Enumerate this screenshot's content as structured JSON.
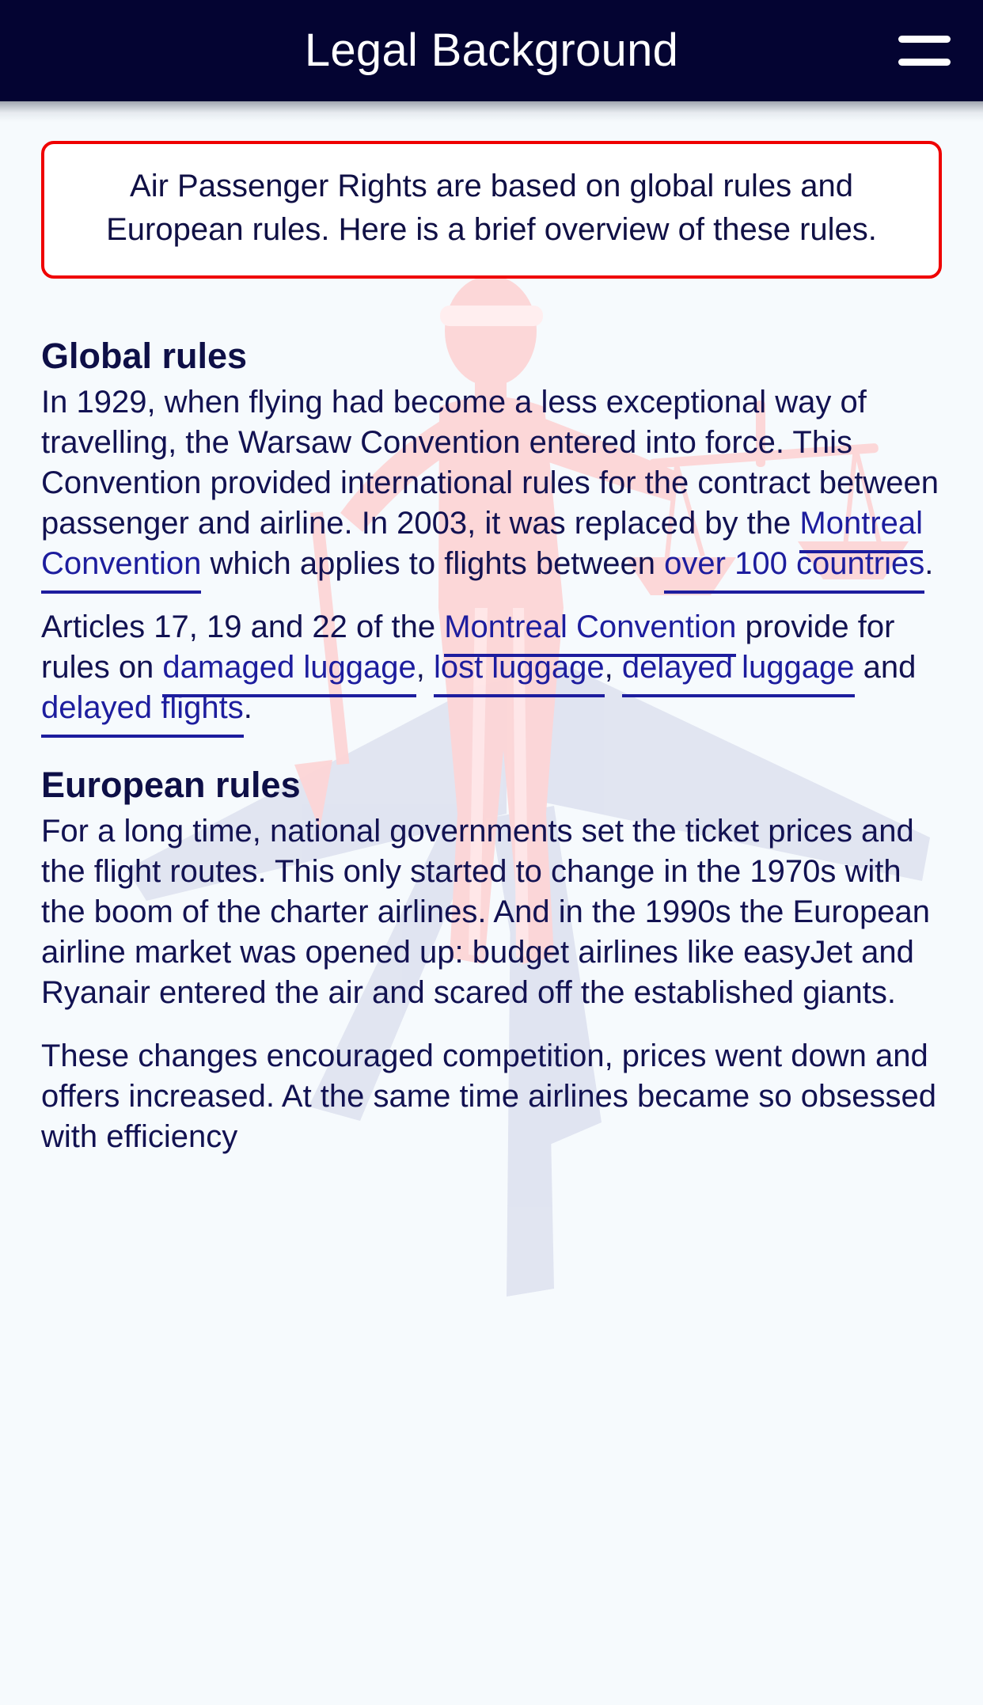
{
  "header": {
    "title": "Legal Background",
    "menu_icon": "hamburger-menu-icon",
    "background_color": "#040432",
    "title_color": "#ffffff"
  },
  "colors": {
    "page_background": "#f6fafd",
    "text": "#121252",
    "heading": "#0e0f47",
    "link": "#1d1d9e",
    "callout_border": "#ef0000",
    "watermark_justice": "#fcd9da",
    "watermark_plane": "#dfe2f0"
  },
  "callout": {
    "text": "Air Passenger Rights are based on global rules and European rules. Here is a brief overview of these rules."
  },
  "sections": [
    {
      "id": "global-rules",
      "heading": "Global rules",
      "paragraphs": [
        {
          "id": "global-p1",
          "parts": [
            {
              "type": "text",
              "value": "In 1929, when flying had become a less exceptional way of travelling, the Warsaw Convention entered into force. This Convention provided international rules for the contract between passenger and airline. In 2003, it was replaced by the "
            },
            {
              "type": "link",
              "value": "Montreal Convention"
            },
            {
              "type": "text",
              "value": " which applies to flights between "
            },
            {
              "type": "link",
              "value": "over 100 countries"
            },
            {
              "type": "text",
              "value": "."
            }
          ]
        },
        {
          "id": "global-p2",
          "parts": [
            {
              "type": "text",
              "value": "Articles 17, 19 and 22 of the "
            },
            {
              "type": "link",
              "value": "Montreal Convention"
            },
            {
              "type": "text",
              "value": " provide for rules on "
            },
            {
              "type": "link",
              "value": "damaged luggage"
            },
            {
              "type": "text",
              "value": ", "
            },
            {
              "type": "link",
              "value": "lost luggage"
            },
            {
              "type": "text",
              "value": ", "
            },
            {
              "type": "link",
              "value": "delayed luggage"
            },
            {
              "type": "text",
              "value": " and "
            },
            {
              "type": "link",
              "value": "delayed flights"
            },
            {
              "type": "text",
              "value": "."
            }
          ]
        }
      ]
    },
    {
      "id": "european-rules",
      "heading": "European rules",
      "paragraphs": [
        {
          "id": "euro-p1",
          "parts": [
            {
              "type": "text",
              "value": "For a long time, national governments set the ticket prices and the flight routes. This only started to change in the 1970s with the boom of the charter airlines. And in the 1990s the European airline market was opened up: budget airlines like easyJet and Ryanair entered the air and scared off the established giants."
            }
          ]
        },
        {
          "id": "euro-p2",
          "parts": [
            {
              "type": "text",
              "value": "These changes encouraged competition, prices went down and offers increased. At the same time airlines became so obsessed with efficiency"
            }
          ]
        }
      ]
    }
  ]
}
